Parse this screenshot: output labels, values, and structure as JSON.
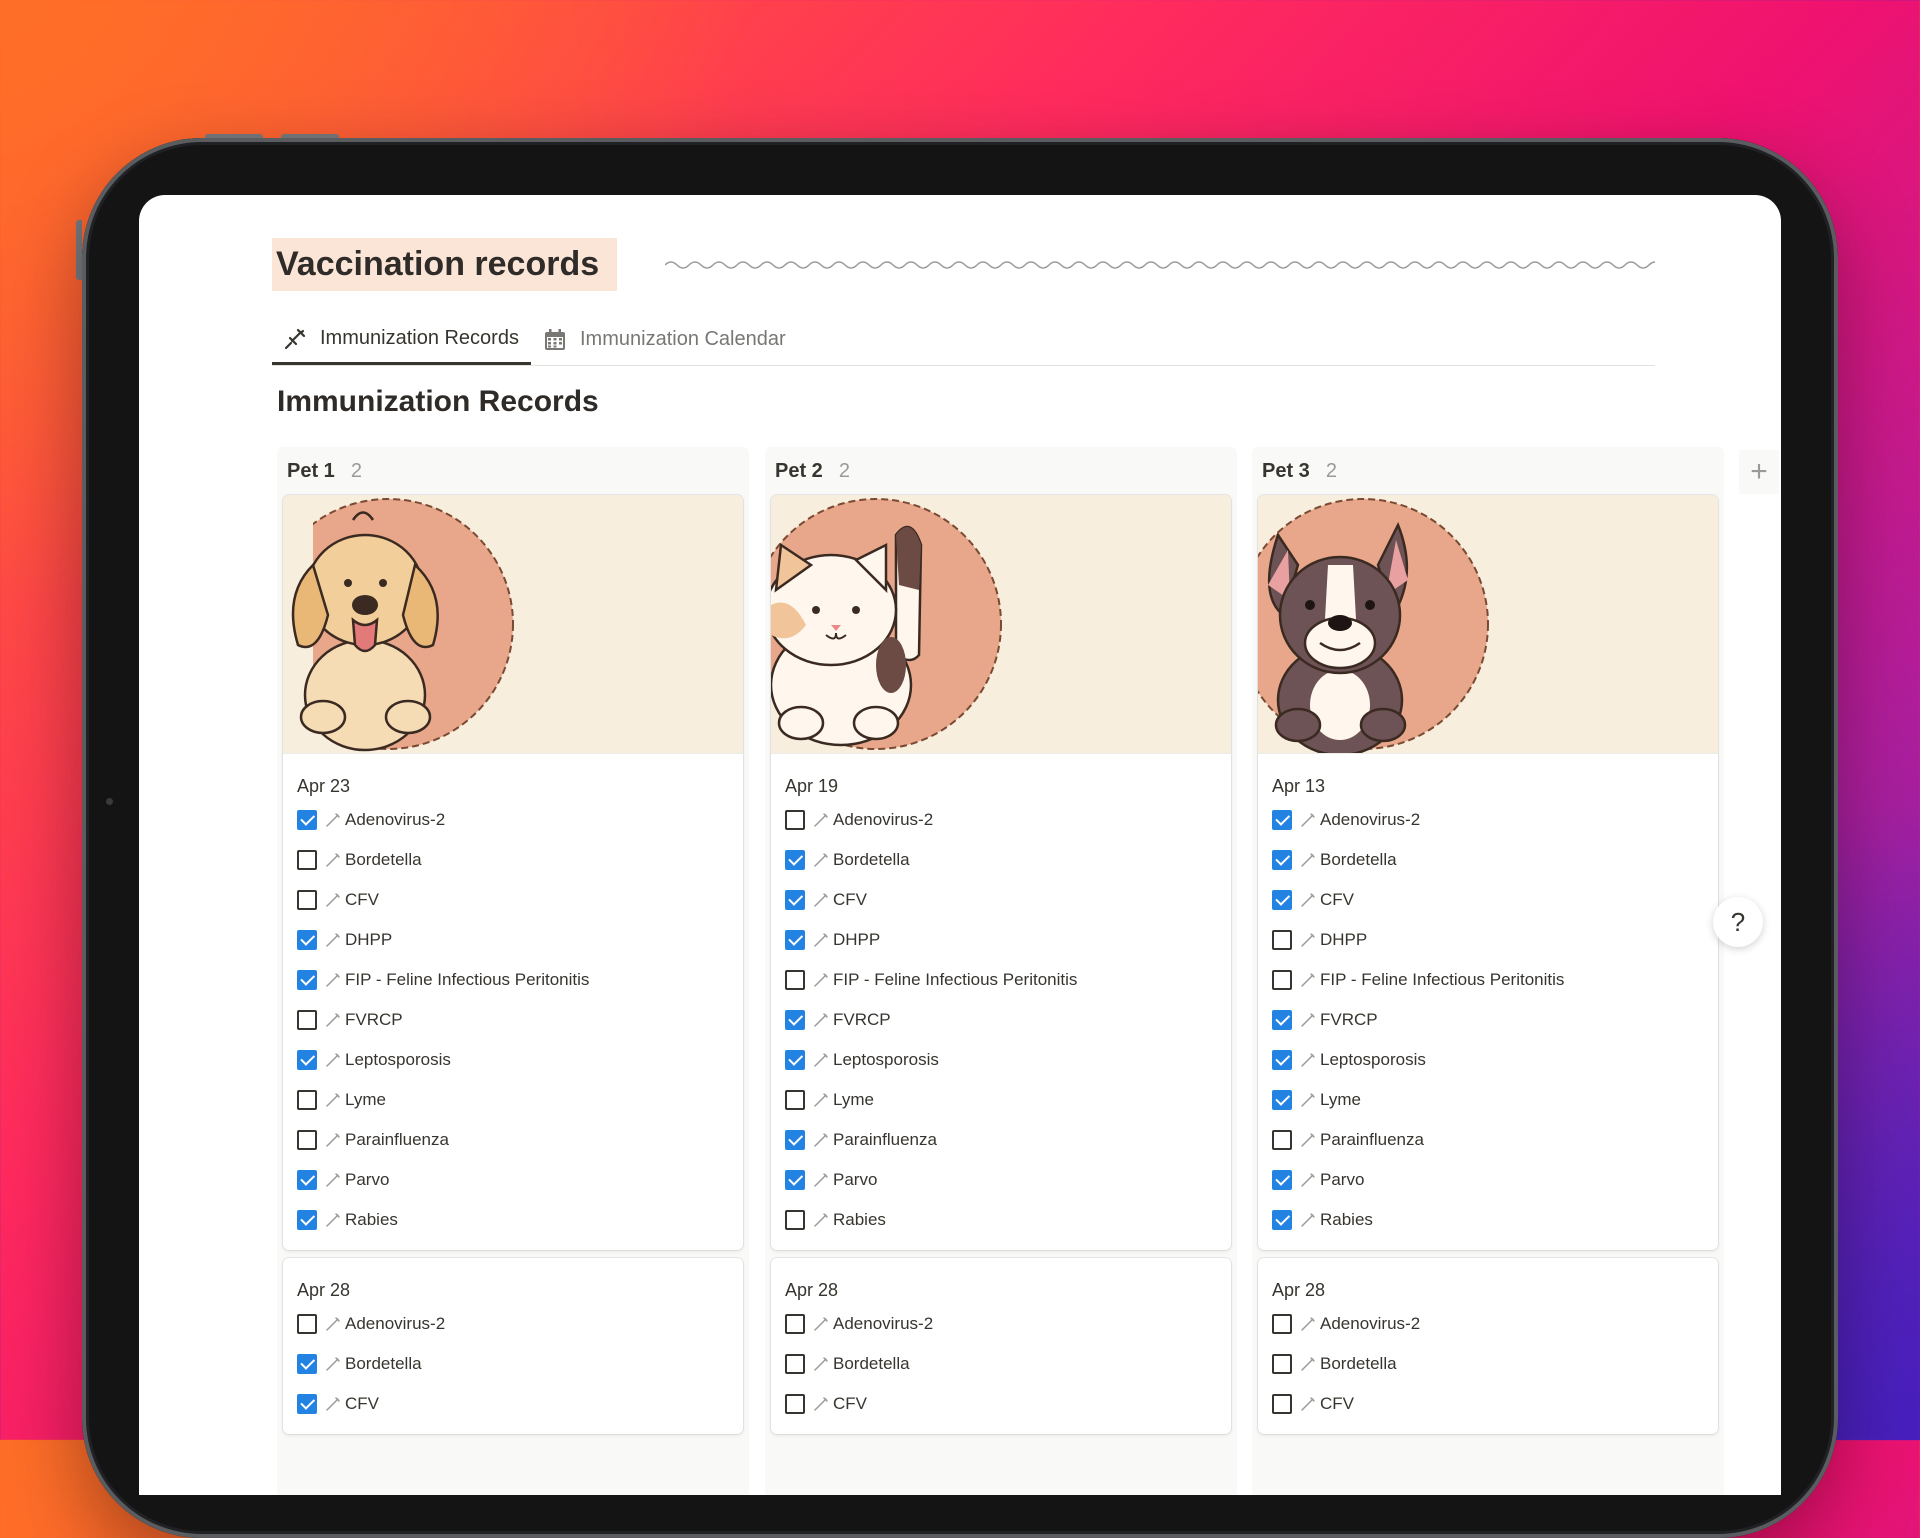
{
  "page": {
    "title": "Vaccination records",
    "tabs": [
      {
        "label": "Immunization Records",
        "icon": "syringe-icon",
        "active": true
      },
      {
        "label": "Immunization Calendar",
        "icon": "calendar-icon",
        "active": false
      }
    ],
    "section_title": "Immunization Records",
    "add_column": "+",
    "help": "?"
  },
  "columns": [
    {
      "name": "Pet 1",
      "count": "2",
      "cards": [
        {
          "cover": "dog-illustration",
          "date": "Apr 23",
          "items": [
            {
              "label": "Adenovirus-2",
              "checked": true
            },
            {
              "label": "Bordetella",
              "checked": false
            },
            {
              "label": "CFV",
              "checked": false
            },
            {
              "label": "DHPP",
              "checked": true
            },
            {
              "label": "FIP - Feline Infectious Peritonitis",
              "checked": true
            },
            {
              "label": "FVRCP",
              "checked": false
            },
            {
              "label": "Leptosporosis",
              "checked": true
            },
            {
              "label": "Lyme",
              "checked": false
            },
            {
              "label": "Parainfluenza",
              "checked": false
            },
            {
              "label": "Parvo",
              "checked": true
            },
            {
              "label": "Rabies",
              "checked": true
            }
          ]
        },
        {
          "date": "Apr 28",
          "items": [
            {
              "label": "Adenovirus-2",
              "checked": false
            },
            {
              "label": "Bordetella",
              "checked": true
            },
            {
              "label": "CFV",
              "checked": true
            }
          ]
        }
      ]
    },
    {
      "name": "Pet 2",
      "count": "2",
      "cards": [
        {
          "cover": "cat-illustration",
          "date": "Apr 19",
          "items": [
            {
              "label": "Adenovirus-2",
              "checked": false
            },
            {
              "label": "Bordetella",
              "checked": true
            },
            {
              "label": "CFV",
              "checked": true
            },
            {
              "label": "DHPP",
              "checked": true
            },
            {
              "label": "FIP - Feline Infectious Peritonitis",
              "checked": false
            },
            {
              "label": "FVRCP",
              "checked": true
            },
            {
              "label": "Leptosporosis",
              "checked": true
            },
            {
              "label": "Lyme",
              "checked": false
            },
            {
              "label": "Parainfluenza",
              "checked": true
            },
            {
              "label": "Parvo",
              "checked": true
            },
            {
              "label": "Rabies",
              "checked": false
            }
          ]
        },
        {
          "date": "Apr 28",
          "items": [
            {
              "label": "Adenovirus-2",
              "checked": false
            },
            {
              "label": "Bordetella",
              "checked": false
            },
            {
              "label": "CFV",
              "checked": false
            }
          ]
        }
      ]
    },
    {
      "name": "Pet 3",
      "count": "2",
      "cards": [
        {
          "cover": "bulldog-illustration",
          "date": "Apr 13",
          "items": [
            {
              "label": "Adenovirus-2",
              "checked": true
            },
            {
              "label": "Bordetella",
              "checked": true
            },
            {
              "label": "CFV",
              "checked": true
            },
            {
              "label": "DHPP",
              "checked": false
            },
            {
              "label": "FIP - Feline Infectious Peritonitis",
              "checked": false
            },
            {
              "label": "FVRCP",
              "checked": true
            },
            {
              "label": "Leptosporosis",
              "checked": true
            },
            {
              "label": "Lyme",
              "checked": true
            },
            {
              "label": "Parainfluenza",
              "checked": false
            },
            {
              "label": "Parvo",
              "checked": true
            },
            {
              "label": "Rabies",
              "checked": true
            }
          ]
        },
        {
          "date": "Apr 28",
          "items": [
            {
              "label": "Adenovirus-2",
              "checked": false
            },
            {
              "label": "Bordetella",
              "checked": false
            },
            {
              "label": "CFV",
              "checked": false
            }
          ]
        }
      ]
    }
  ],
  "colors": {
    "accent": "#2383e2",
    "title_highlight": "#fbe5d7",
    "cover_bg": "#f7eedd",
    "cover_circle": "#e8a78a"
  }
}
